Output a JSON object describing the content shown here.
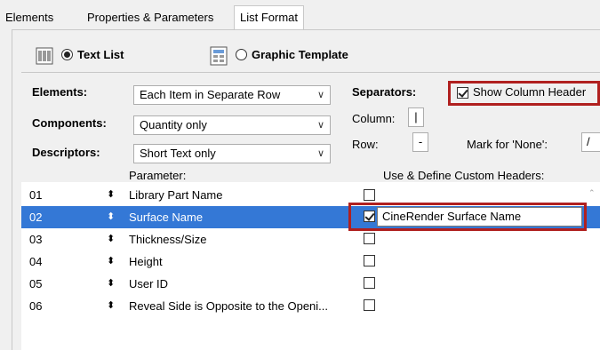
{
  "tabs": [
    {
      "label": "Elements"
    },
    {
      "label": "Properties & Parameters"
    },
    {
      "label": "List Format"
    }
  ],
  "mode": {
    "text_list_label": "Text List",
    "graphic_template_label": "Graphic Template",
    "selected": "Text List"
  },
  "form": {
    "elements_label": "Elements:",
    "elements_value": "Each Item in Separate Row",
    "components_label": "Components:",
    "components_value": "Quantity only",
    "descriptors_label": "Descriptors:",
    "descriptors_value": "Short Text only",
    "separators_label": "Separators:",
    "show_column_header_label": "Show Column Header",
    "show_column_header_checked": true,
    "column_label": "Column:",
    "column_value": "|",
    "row_label": "Row:",
    "row_value": "-",
    "mark_none_label": "Mark for 'None':",
    "mark_none_value": "/"
  },
  "list": {
    "parameter_header": "Parameter:",
    "custom_header": "Use & Define Custom Headers:",
    "rows": [
      {
        "num": "01",
        "sort": "↕",
        "name": "Library Part Name",
        "checked": false
      },
      {
        "num": "02",
        "sort": "↕",
        "name": "Surface Name",
        "checked": true,
        "custom": "CineRender Surface Name",
        "selected": true
      },
      {
        "num": "03",
        "sort": "↕",
        "name": "Thickness/Size",
        "checked": false
      },
      {
        "num": "04",
        "sort": "↕",
        "name": "Height",
        "checked": false
      },
      {
        "num": "05",
        "sort": "↕",
        "name": "User ID",
        "checked": false
      },
      {
        "num": "06",
        "sort": "↕",
        "name": "Reveal Side is Opposite to the Openi...",
        "checked": false
      }
    ]
  },
  "icons": {
    "text_list": "text-list-icon",
    "graphic_template": "graphic-template-icon"
  },
  "colors": {
    "selection": "#3478d6",
    "highlight": "#b0201f"
  }
}
